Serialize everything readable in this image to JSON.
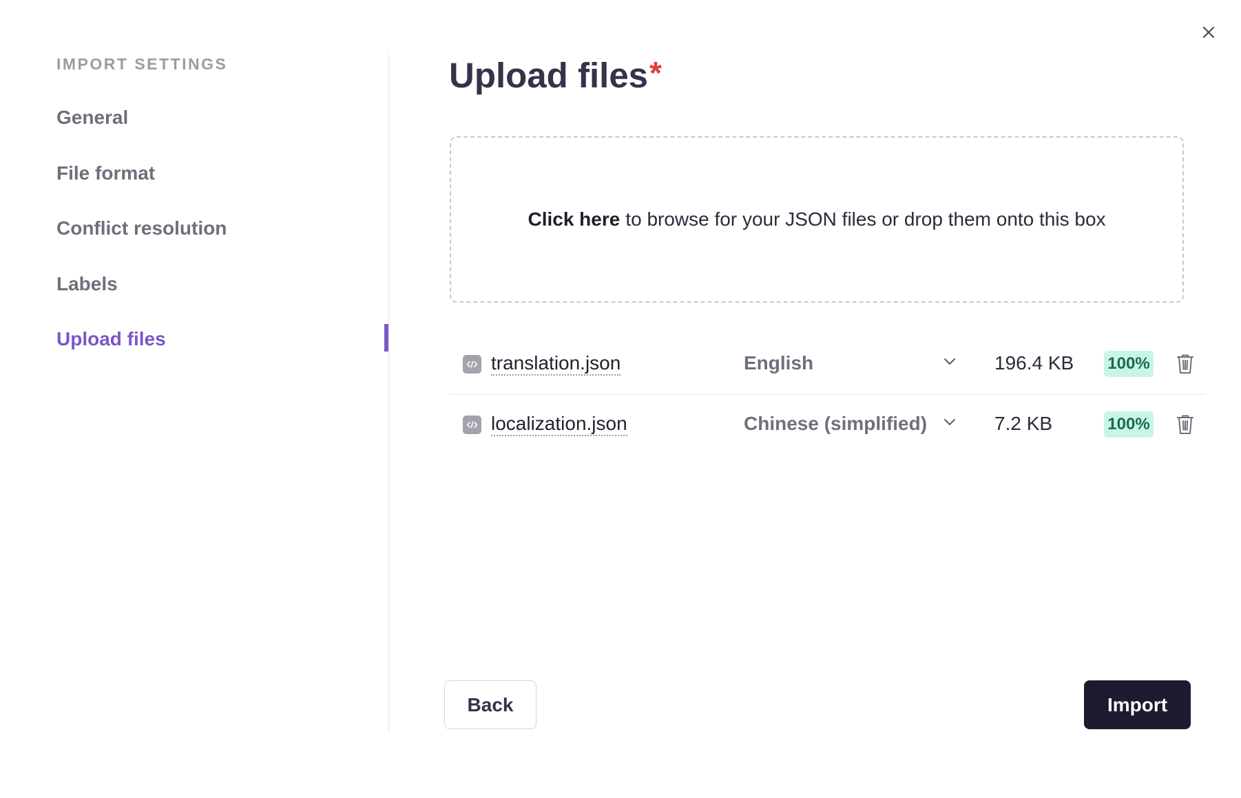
{
  "sidebar": {
    "heading": "IMPORT SETTINGS",
    "items": [
      {
        "label": "General",
        "active": false
      },
      {
        "label": "File format",
        "active": false
      },
      {
        "label": "Conflict resolution",
        "active": false
      },
      {
        "label": "Labels",
        "active": false
      },
      {
        "label": "Upload files",
        "active": true
      }
    ],
    "active_color": "#7b57c7"
  },
  "main": {
    "title": "Upload files",
    "required_marker": "*",
    "dropzone": {
      "link_text": "Click here",
      "text": "to browse for your JSON files or drop them onto this box"
    },
    "files": [
      {
        "name": "translation.json",
        "language": "English",
        "size": "196.4 KB",
        "progress": "100%"
      },
      {
        "name": "localization.json",
        "language": "Chinese (simplified)",
        "size": "7.2 KB",
        "progress": "100%"
      }
    ]
  },
  "footer": {
    "back_label": "Back",
    "import_label": "Import"
  },
  "icons": {
    "close": "close-icon",
    "file": "code-file-icon",
    "chevron": "chevron-down-icon",
    "trash": "trash-icon"
  }
}
